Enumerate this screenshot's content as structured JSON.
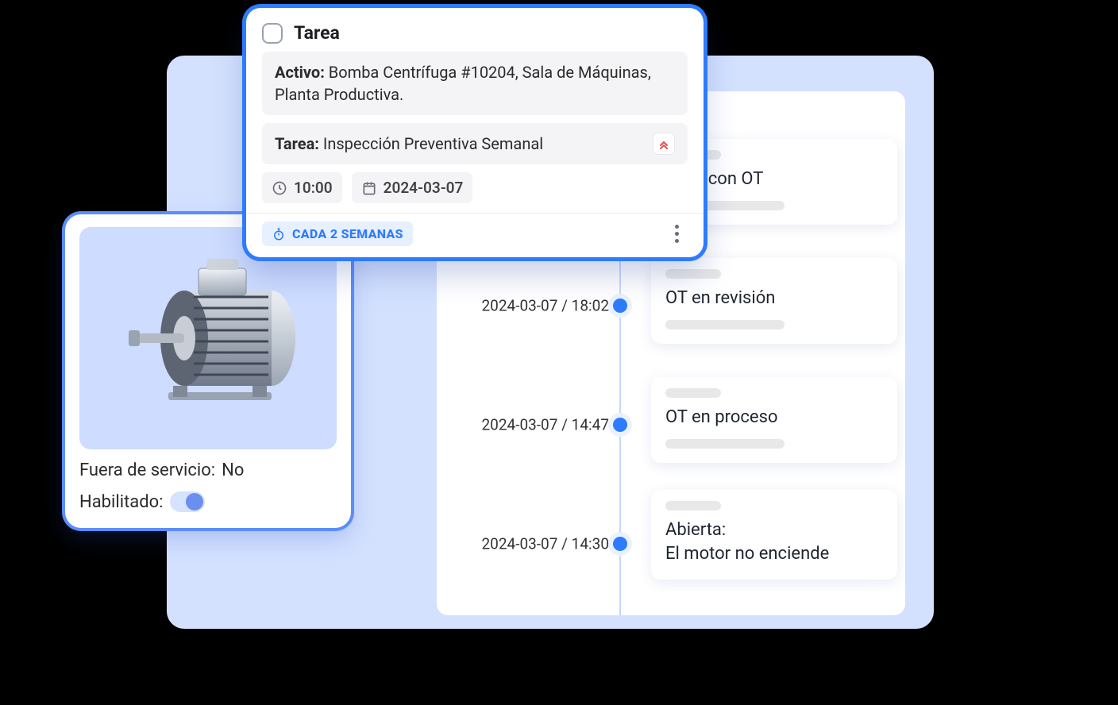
{
  "task": {
    "header_label": "Tarea",
    "asset_label": "Activo:",
    "asset_value": "Bomba Centrífuga #10204, Sala de Máquinas, Planta Productiva.",
    "name_label": "Tarea:",
    "name_value": "Inspección Preventiva Semanal",
    "time": "10:00",
    "date": "2024-03-07",
    "frequency": "CADA 2 SEMANAS"
  },
  "asset_card": {
    "out_of_service_label": "Fuera de servicio:",
    "out_of_service_value": "No",
    "enabled_label": "Habilitado:"
  },
  "timeline": [
    {
      "time": "",
      "title_partial": "uelta con OT"
    },
    {
      "time": "2024-03-07 / 18:02",
      "title": "OT en revisión"
    },
    {
      "time": "2024-03-07 / 14:47",
      "title": "OT en proceso"
    },
    {
      "time": "2024-03-07 / 14:30",
      "title": "Abierta:\nEl motor no enciende"
    }
  ]
}
